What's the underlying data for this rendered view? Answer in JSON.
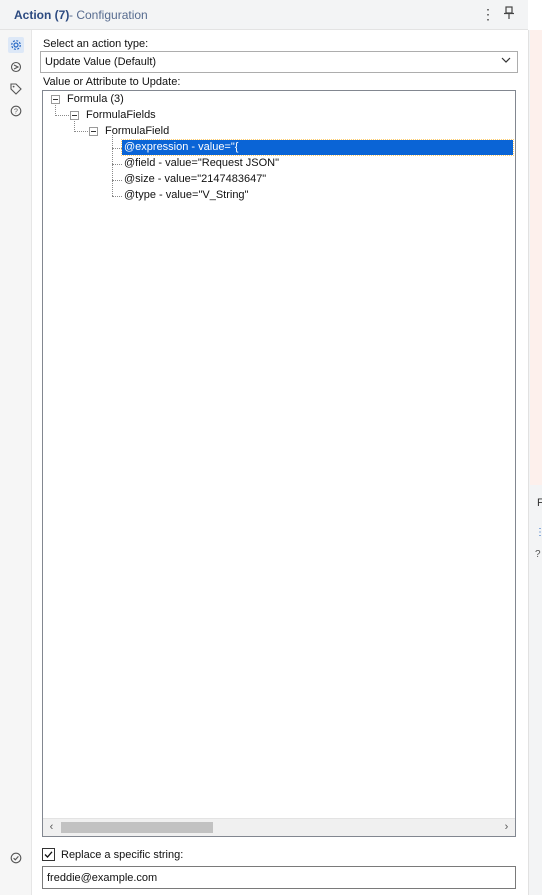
{
  "header": {
    "title": "Action (7)",
    "subtitle": "- Configuration",
    "more_icon": "kebab-vertical-icon",
    "pin_icon": "pin-icon"
  },
  "rail": {
    "icons": [
      "gear-icon",
      "target-icon",
      "tag-icon",
      "help-icon"
    ],
    "bottom_icon": "check-circle-icon"
  },
  "form": {
    "action_type_label": "Select an action type:",
    "action_type_value": "Update Value (Default)",
    "value_label": "Value or Attribute to Update:",
    "replace_label": "Replace a specific string:",
    "replace_checked": true,
    "replace_value": "freddie@example.com"
  },
  "tree": {
    "root": "Formula (3)",
    "level1": "FormulaFields",
    "level2": "FormulaField",
    "leaves": [
      "@expression - value=\"{",
      "@field - value=\"Request JSON\"",
      "@size - value=\"2147483647\"",
      "@type - value=\"V_String\""
    ],
    "selected_index": 0
  },
  "right_strip": {
    "letter": "F"
  },
  "colors": {
    "header_bg": "#f3f4f5",
    "title": "#2c4a80",
    "selection": "#0a64d6",
    "accent": "#2a6bc5"
  }
}
